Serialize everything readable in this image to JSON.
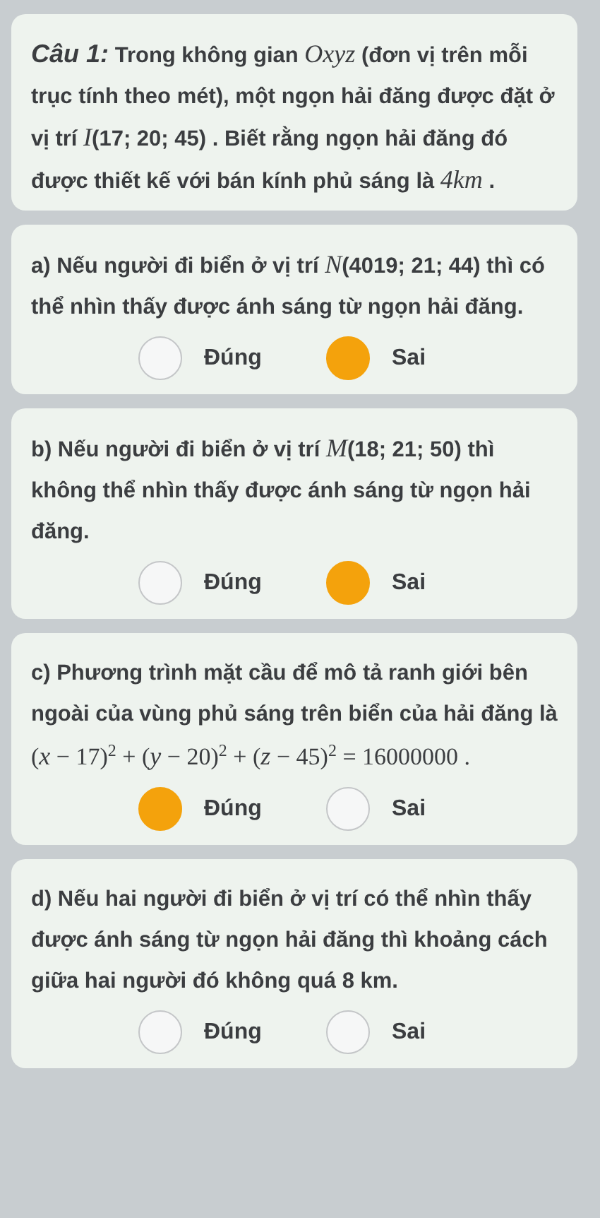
{
  "question": {
    "label": "Câu 1:",
    "text": "Trong không gian *Oxyz* (đơn vị trên mỗi trục tính theo mét), một ngọn hải đăng được đặt ở vị trí *I*(17; 20; 45) . Biết rằng ngọn hải đăng đó được thiết kế với bán kính phủ sáng là *4km* ."
  },
  "statements": [
    {
      "text": "a) Nếu người đi biển ở vị trí *N*(4019; 21; 44) thì có thể nhìn thấy được ánh sáng từ ngọn hải đăng.",
      "options": [
        {
          "label": "Đúng",
          "selected": false
        },
        {
          "label": "Sai",
          "selected": true
        }
      ]
    },
    {
      "text": "b) Nếu người đi biển ở vị trí *M*(18; 21; 50) thì không thể nhìn thấy được ánh sáng từ ngọn hải đăng.",
      "options": [
        {
          "label": "Đúng",
          "selected": false
        },
        {
          "label": "Sai",
          "selected": true
        }
      ]
    },
    {
      "text": "c) Phương trình mặt cầu để mô tả ranh giới bên ngoài của vùng phủ sáng trên biển của hải đăng là",
      "formula": "(*x* − 17)$^{2}$ + (*y* − 20)$^{2}$ + (*z* − 45)$^{2}$ = 16000000 .",
      "options": [
        {
          "label": "Đúng",
          "selected": true
        },
        {
          "label": "Sai",
          "selected": false
        }
      ]
    },
    {
      "text": "d) Nếu hai người đi biển ở vị trí có thể nhìn thấy được ánh sáng từ ngọn hải đăng thì khoảng cách giữa hai người đó không quá 8 km.",
      "options": [
        {
          "label": "Đúng",
          "selected": false
        },
        {
          "label": "Sai",
          "selected": false
        }
      ]
    }
  ]
}
